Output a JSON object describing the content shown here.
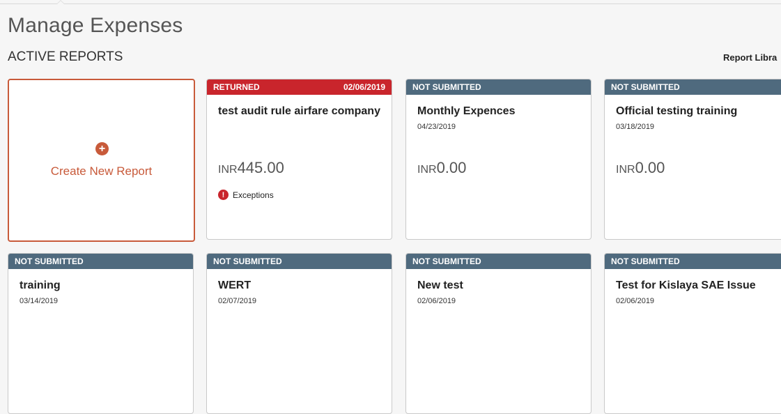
{
  "page": {
    "title": "Manage Expenses",
    "section_title": "ACTIVE REPORTS",
    "report_library_label": "Report Libra"
  },
  "create_tile": {
    "label": "Create New Report",
    "icon": "plus-circle-icon"
  },
  "colors": {
    "returned": "#c9252c",
    "not_submitted": "#4f6a7e",
    "accent": "#c85a3a"
  },
  "reports": [
    {
      "status": "RETURNED",
      "status_date": "02/06/2019",
      "name": "test audit rule airfare company",
      "date": "",
      "currency": "INR",
      "amount": "445.00",
      "exception_label": "Exceptions"
    },
    {
      "status": "NOT SUBMITTED",
      "status_date": "",
      "name": "Monthly Expences",
      "date": "04/23/2019",
      "currency": "INR",
      "amount": "0.00"
    },
    {
      "status": "NOT SUBMITTED",
      "status_date": "",
      "name": "Official testing training",
      "date": "03/18/2019",
      "currency": "INR",
      "amount": "0.00"
    },
    {
      "status": "NOT SUBMITTED",
      "status_date": "",
      "name": "training",
      "date": "03/14/2019"
    },
    {
      "status": "NOT SUBMITTED",
      "status_date": "",
      "name": "WERT",
      "date": "02/07/2019"
    },
    {
      "status": "NOT SUBMITTED",
      "status_date": "",
      "name": "New test",
      "date": "02/06/2019"
    },
    {
      "status": "NOT SUBMITTED",
      "status_date": "",
      "name": "Test for Kislaya SAE Issue",
      "date": "02/06/2019"
    }
  ]
}
